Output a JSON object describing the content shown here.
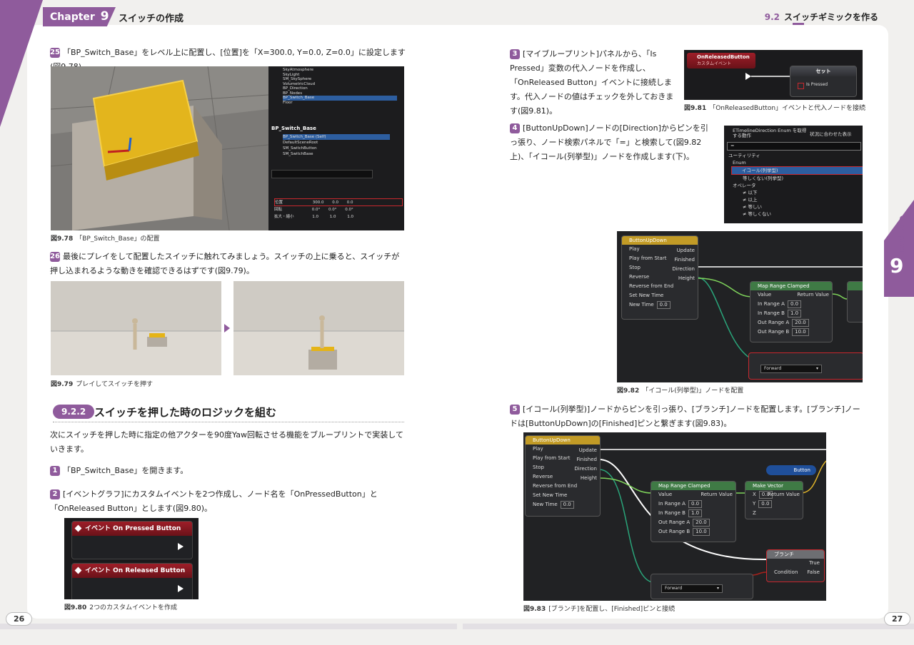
{
  "header": {
    "chapter_label": "Chapter",
    "chapter_num": "9",
    "left_title": "スイッチの作成",
    "right_section": "9.2",
    "right_title": "スイッチギミックを作る"
  },
  "side_tab": {
    "label": "Chapter",
    "num": "9"
  },
  "page_numbers": {
    "left": "26",
    "right": "27"
  },
  "left": {
    "step25": {
      "num": "25",
      "text": "「BP_Switch_Base」をレベル上に配置し、[位置]を「X=300.0, Y=0.0, Z=0.0」に設定します(図9.78)。"
    },
    "fig78": {
      "num": "図9.78",
      "caption": "「BP_Switch_Base」の配置",
      "outliner_items": [
        "SkyAtmosphere",
        "SkyLight",
        "SM_SkySphere",
        "VolumetricCloud",
        "BP_Direction",
        "BP_Nodes",
        "BP_Switch_Base",
        "Floor"
      ],
      "comp_title": "BP_Switch_Base",
      "comp_items": [
        "BP_Switch_Base (Self)",
        "DefaultSceneRoot",
        "SM_SwitchButton",
        "SM_SwitchBase"
      ],
      "search_icon_label": "検索",
      "transform_rows": [
        {
          "label": "位置",
          "x": "300.0",
          "y": "0.0",
          "z": "0.0"
        },
        {
          "label": "回転",
          "x": "0.0°",
          "y": "0.0°",
          "z": "0.0°"
        },
        {
          "label": "拡大・縮小",
          "x": "1.0",
          "y": "1.0",
          "z": "1.0"
        }
      ]
    },
    "step26": {
      "num": "26",
      "text": "最後にプレイをして配置したスイッチに触れてみましょう。スイッチの上に乗ると、スイッチが押し込まれるような動きを確認できるはずです(図9.79)。"
    },
    "fig79": {
      "num": "図9.79",
      "caption": "プレイしてスイッチを押す"
    },
    "section": {
      "num": "9.2.2",
      "title": "スイッチを押した時のロジックを組む"
    },
    "intro": "次にスイッチを押した時に指定の他アクターを90度Yaw回転させる機能をブループリントで実装していきます。",
    "step1": {
      "num": "1",
      "text": "「BP_Switch_Base」を開きます。"
    },
    "step2": {
      "num": "2",
      "text": "[イベントグラフ]にカスタムイベントを2つ作成し、ノード名を「OnPressedButton」と「OnReleased Button」とします(図9.80)。"
    },
    "fig80": {
      "num": "図9.80",
      "caption": "2つのカスタムイベントを作成",
      "event1": "イベント On Pressed Button",
      "event2": "イベント On Released Button"
    }
  },
  "right": {
    "step3": {
      "num": "3",
      "text": "[マイブループリント]パネルから、「Is Pressed」変数の代入ノードを作成し、「OnReleased Button」イベントに接続します。代入ノードの値はチェックを外しておきます(図9.81)。"
    },
    "fig81": {
      "num": "図9.81",
      "caption": "「OnReleasedButton」イベントと代入ノードを接続",
      "event_title": "OnReleasedButton",
      "event_sub": "カスタムイベント",
      "set_title": "セット",
      "set_pin": "Is Pressed"
    },
    "step4": {
      "num": "4",
      "text": "[ButtonUpDown]ノードの[Direction]からピンを引っ張り、ノード検索パネルで「=」と検索して(図9.82上)、「イコール(列挙型)」ノードを作成します(下)。"
    },
    "fig82_search": {
      "title": "ETimelineDirection Enum を取得する動作",
      "context": "状況に合わせた表示",
      "query": "=",
      "cat1": "ユーティリティ",
      "cat2": "Enum",
      "item_sel": "イコール(列挙型)",
      "item2": "等しくない(列挙型)",
      "cat3": "オペレータ",
      "ops": [
        "≠ 以下",
        "≠ 以上",
        "≠ 等しい",
        "≠ 等しくない"
      ]
    },
    "fig82": {
      "num": "図9.82",
      "caption": "「イコール(列挙型)」ノードを配置",
      "tl_title": "ButtonUpDown",
      "tl_inputs": [
        "Play",
        "Play from Start",
        "Stop",
        "Reverse",
        "Reverse from End",
        "Set New Time",
        "New Time"
      ],
      "tl_outputs": [
        "Update",
        "Finished",
        "Direction",
        "Height"
      ],
      "new_time_val": "0.0",
      "map_title": "Map Range Clamped",
      "map_inputs": [
        "Value",
        "In Range A",
        "In Range B",
        "Out Range A",
        "Out Range B"
      ],
      "map_vals": [
        "0.0",
        "1.0",
        "20.0",
        "10.0"
      ],
      "map_out": "Return Value",
      "enum_val": "Forward"
    },
    "step5": {
      "num": "5",
      "text": "[イコール(列挙型)]ノードからピンを引っ張り、[ブランチ]ノードを配置します。[ブランチ]ノードは[ButtonUpDown]の[Finished]ピンと繋ぎます(図9.83)。"
    },
    "fig83": {
      "num": "図9.83",
      "caption": "[ブランチ]を配置し、[Finished]ピンと接続",
      "make_vec": "Make Vector",
      "make_vec_pins": [
        "X",
        "Y",
        "Z"
      ],
      "make_vec_vals": [
        "0.0",
        "0.0"
      ],
      "button_var": "Button",
      "branch_title": "ブランチ",
      "branch_in": "Condition",
      "branch_out": [
        "True",
        "False"
      ]
    }
  }
}
